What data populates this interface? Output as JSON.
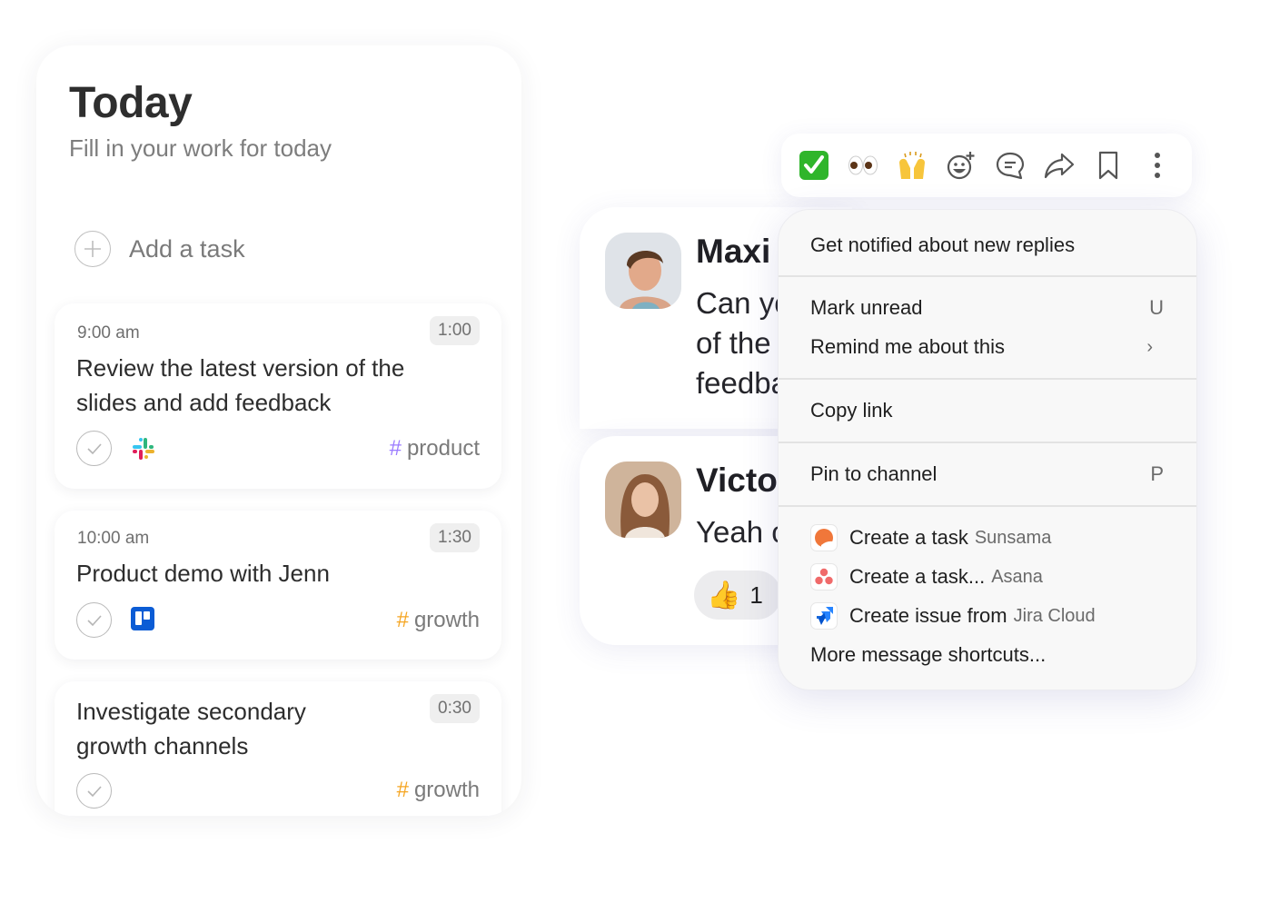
{
  "today": {
    "title": "Today",
    "subtitle": "Fill in your work for today",
    "add_task_label": "Add a task",
    "tasks": [
      {
        "time": "9:00 am",
        "duration": "1:00",
        "title_lines": [
          "Review the latest version of the",
          "slides and add feedback"
        ],
        "source_icon": "slack-icon",
        "tag": "product",
        "tag_color": "#9b7bff"
      },
      {
        "time": "10:00 am",
        "duration": "1:30",
        "title_lines": [
          "Product demo with Jenn"
        ],
        "source_icon": "trello-icon",
        "tag": "growth",
        "tag_color": "#f5a623"
      },
      {
        "time": "",
        "duration": "0:30",
        "title_lines": [
          "Investigate secondary",
          "growth channels"
        ],
        "source_icon": "",
        "tag": "growth",
        "tag_color": "#f5a623"
      }
    ],
    "tag_hash": "#"
  },
  "messages": [
    {
      "name": "Maxi",
      "text_lines": [
        "Can yo",
        "of the",
        "feedba"
      ]
    },
    {
      "name": "Victo",
      "text_lines": [
        "Yeah c"
      ],
      "reaction": {
        "emoji": "👍",
        "count": "1"
      }
    }
  ],
  "toolbar": {
    "items": [
      {
        "icon": "check-mark-emoji-icon",
        "glyph": "✅"
      },
      {
        "icon": "eyes-emoji-icon",
        "glyph": "👀"
      },
      {
        "icon": "raising-hands-emoji-icon",
        "glyph": "🙌"
      },
      {
        "icon": "add-reaction-icon"
      },
      {
        "icon": "reply-in-thread-icon"
      },
      {
        "icon": "share-icon"
      },
      {
        "icon": "bookmark-icon"
      },
      {
        "icon": "more-options-icon"
      }
    ]
  },
  "menu": {
    "get_notified": "Get notified about new replies",
    "mark_unread": "Mark unread",
    "mark_unread_shortcut": "U",
    "remind_me": "Remind me about this",
    "remind_chevron": "›",
    "copy_link": "Copy link",
    "pin_to_channel": "Pin to channel",
    "pin_shortcut": "P",
    "shortcuts": [
      {
        "action": "Create a task",
        "app": "Sunsama"
      },
      {
        "action": "Create a task...",
        "app": "Asana"
      },
      {
        "action": "Create issue from",
        "app": "Jira Cloud"
      }
    ],
    "more_shortcuts": "More message shortcuts..."
  }
}
